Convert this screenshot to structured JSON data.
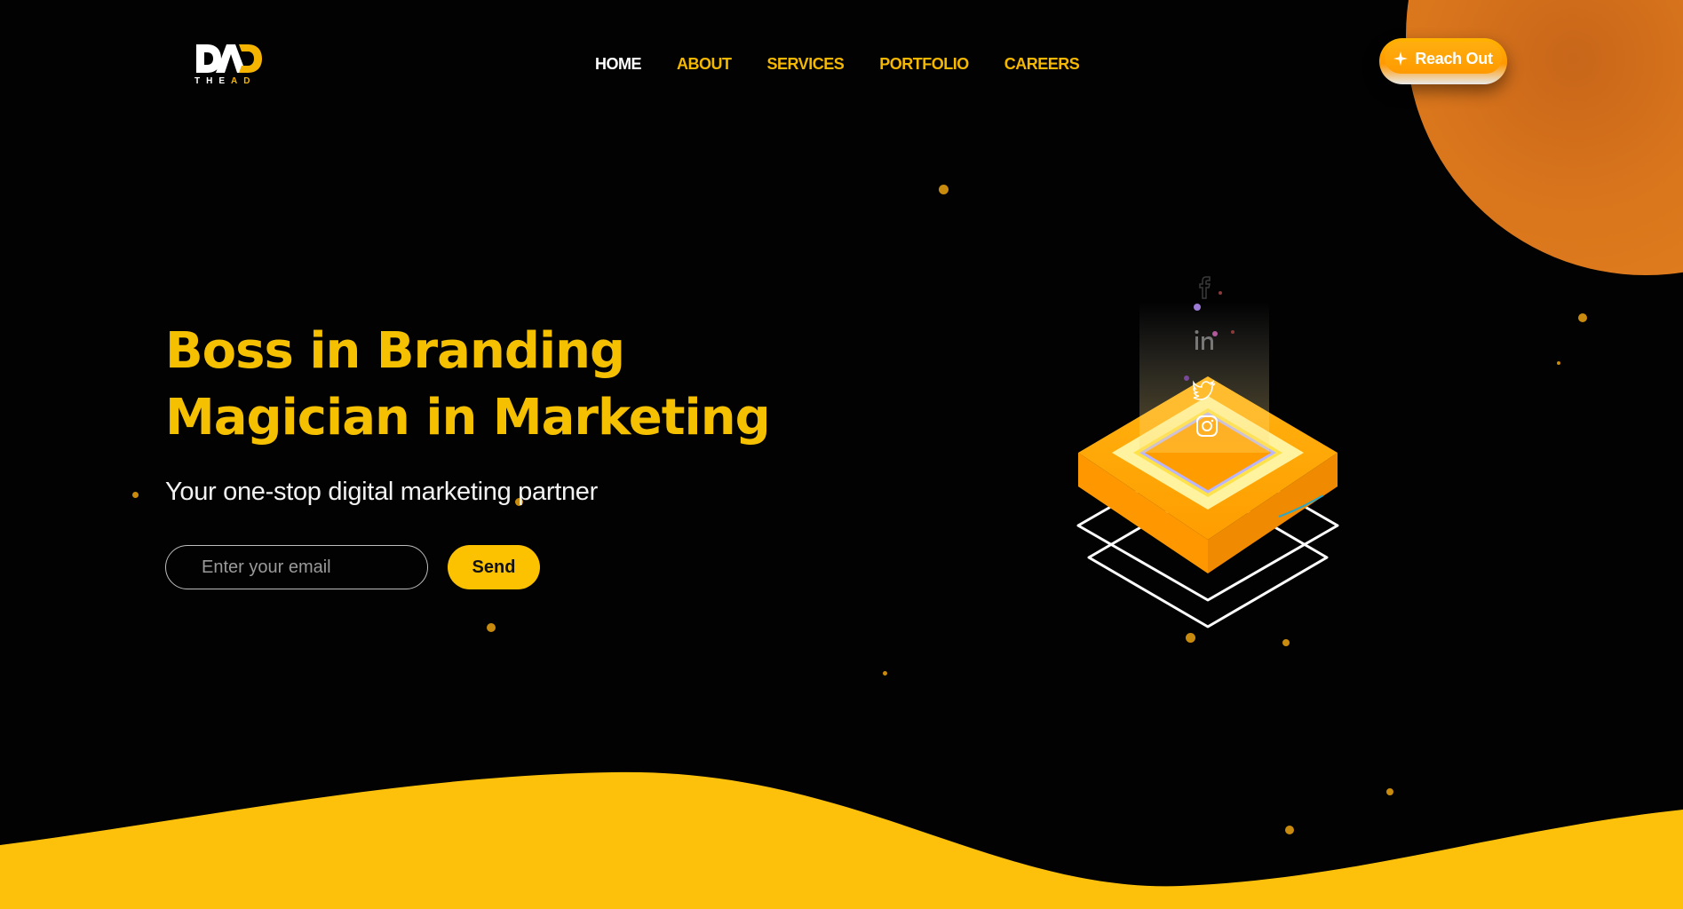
{
  "header": {
    "logo": {
      "sub_white": "THE",
      "sub_accent": "AD"
    },
    "nav": [
      {
        "label": "HOME",
        "active": true
      },
      {
        "label": "ABOUT",
        "active": false
      },
      {
        "label": "SERVICES",
        "active": false
      },
      {
        "label": "PORTFOLIO",
        "active": false
      },
      {
        "label": "CAREERS",
        "active": false
      }
    ],
    "cta": {
      "label": "Reach Out",
      "icon": "sparkle-icon"
    }
  },
  "hero": {
    "title_line1": "Boss in Branding",
    "title_line2": "Magician in Marketing",
    "subtitle": "Your one-stop digital marketing partner",
    "email_placeholder": "Enter your email",
    "send_label": "Send"
  },
  "illustration": {
    "social_icons": [
      "facebook-icon",
      "linkedin-icon",
      "twitter-icon",
      "instagram-icon"
    ]
  },
  "colors": {
    "background": "#020202",
    "accent_yellow": "#f5c000",
    "accent_orange": "#df7e1e",
    "wave_yellow": "#fec10b",
    "text_white": "#f2f2f2"
  }
}
